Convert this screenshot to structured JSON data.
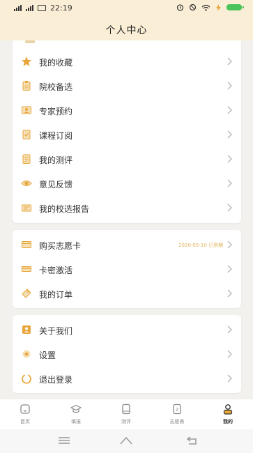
{
  "status_bar": {
    "time": "22:19"
  },
  "page_title": "个人中心",
  "colors": {
    "accent": "#e8a63a",
    "header_bg": "#fbeed6",
    "note": "#e2b25a"
  },
  "menu_group_1": [
    {
      "label": "我的收藏",
      "icon": "star-icon"
    },
    {
      "label": "院校备选",
      "icon": "clipboard-icon"
    },
    {
      "label": "专家预约",
      "icon": "expert-icon"
    },
    {
      "label": "课程订阅",
      "icon": "course-icon"
    },
    {
      "label": "我的测评",
      "icon": "test-icon"
    },
    {
      "label": "意见反馈",
      "icon": "eye-icon"
    },
    {
      "label": "我的校选报告",
      "icon": "report-icon"
    }
  ],
  "menu_group_2": [
    {
      "label": "购买志愿卡",
      "icon": "card-icon",
      "note": "2020-05-10 已到期"
    },
    {
      "label": "卡密激活",
      "icon": "activation-icon"
    },
    {
      "label": "我的订单",
      "icon": "order-icon"
    }
  ],
  "menu_group_3": [
    {
      "label": "关于我们",
      "icon": "about-icon"
    },
    {
      "label": "设置",
      "icon": "settings-icon"
    },
    {
      "label": "退出登录",
      "icon": "logout-icon"
    }
  ],
  "tabs": [
    {
      "label": "首页",
      "icon": "home-icon"
    },
    {
      "label": "填报",
      "icon": "graduation-cap-icon"
    },
    {
      "label": "测评",
      "icon": "test-tab-icon"
    },
    {
      "label": "志愿表",
      "icon": "volunteer-form-icon"
    },
    {
      "label": "我的",
      "icon": "user-icon",
      "active": true
    }
  ]
}
